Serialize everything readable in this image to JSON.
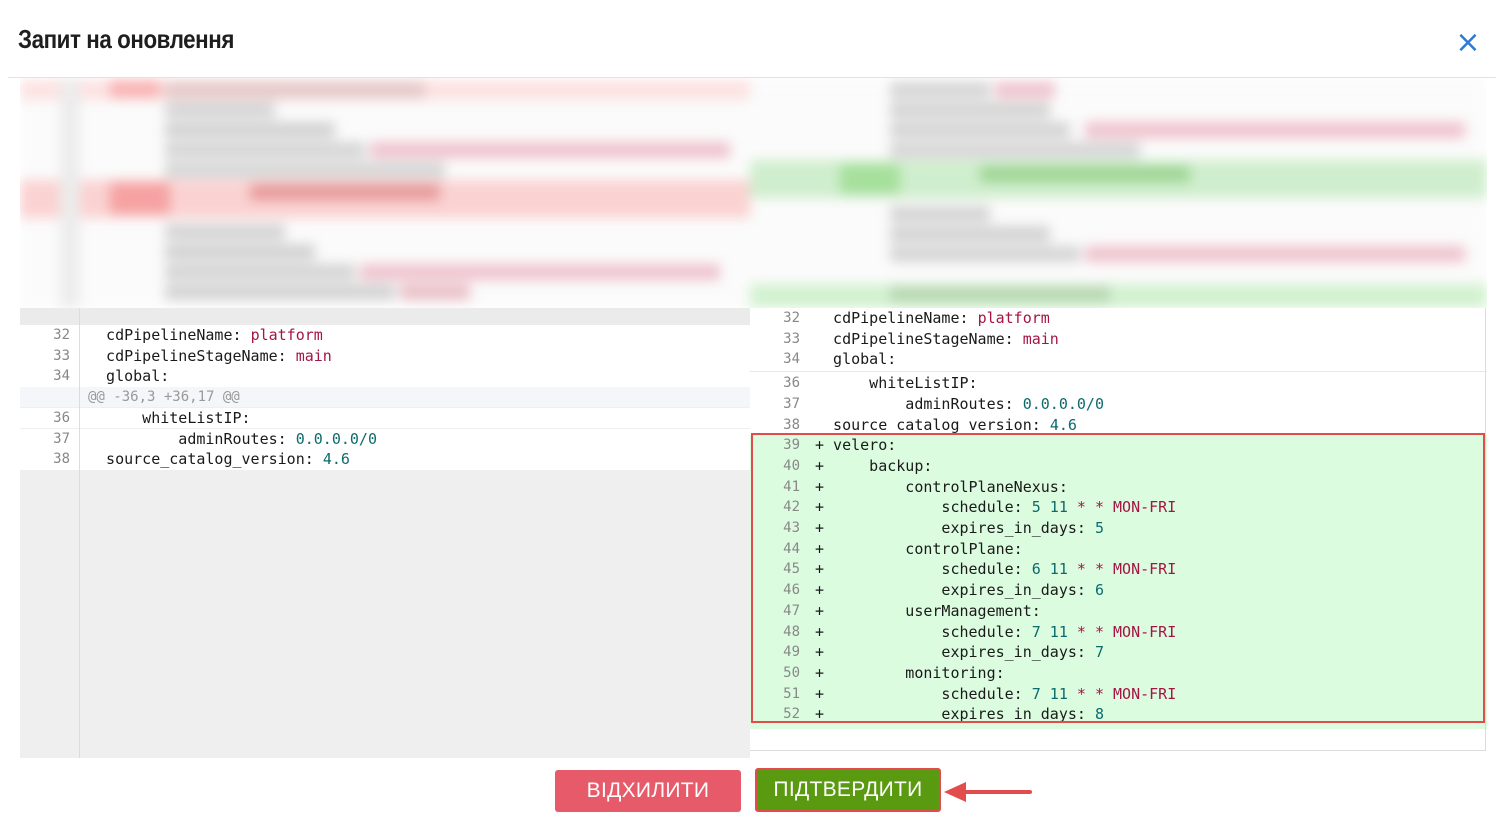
{
  "modal": {
    "title": "Запит на оновлення",
    "close_icon": "×"
  },
  "diff": {
    "hunk_header": "@@ -36,3 +36,17 @@",
    "left_rows": [
      {
        "ln": "32",
        "key": "  cdPipelineName: ",
        "val": "platform",
        "type": "s"
      },
      {
        "ln": "33",
        "key": "  cdPipelineStageName: ",
        "val": "main",
        "type": "s"
      },
      {
        "ln": "34",
        "key": "  global:",
        "val": "",
        "type": ""
      },
      {
        "ln": "36",
        "key": "      whiteListIP:",
        "val": "",
        "type": ""
      },
      {
        "ln": "37",
        "key": "          adminRoutes: ",
        "val": "0.0.0.0/0",
        "type": "n"
      },
      {
        "ln": "38",
        "key": "  source_catalog_version: ",
        "val": "4.6",
        "type": "n"
      }
    ],
    "right_rows": [
      {
        "ln": "32",
        "key": "  cdPipelineName: ",
        "val": "platform",
        "type": "s"
      },
      {
        "ln": "33",
        "key": "  cdPipelineStageName: ",
        "val": "main",
        "type": "s"
      },
      {
        "ln": "34",
        "key": "  global:",
        "val": "",
        "type": ""
      },
      {
        "ln": "36",
        "key": "      whiteListIP:",
        "val": "",
        "type": ""
      },
      {
        "ln": "37",
        "key": "          adminRoutes: ",
        "val": "0.0.0.0/0",
        "type": "n"
      },
      {
        "ln": "38",
        "key": "  source_catalog_version: ",
        "val": "4.6",
        "type": "n"
      }
    ],
    "added_rows": [
      {
        "ln": "39",
        "key": "+ velero:",
        "parts": []
      },
      {
        "ln": "40",
        "key": "+     backup:",
        "parts": []
      },
      {
        "ln": "41",
        "key": "+         controlPlaneNexus:",
        "parts": []
      },
      {
        "ln": "42",
        "key": "+             schedule: ",
        "parts": [
          [
            "5 11",
            "n"
          ],
          [
            " * * ",
            "s"
          ],
          [
            "MON-FRI",
            "s"
          ]
        ]
      },
      {
        "ln": "43",
        "key": "+             expires_in_days: ",
        "parts": [
          [
            "5",
            "n"
          ]
        ]
      },
      {
        "ln": "44",
        "key": "+         controlPlane:",
        "parts": []
      },
      {
        "ln": "45",
        "key": "+             schedule: ",
        "parts": [
          [
            "6 11",
            "n"
          ],
          [
            " * * ",
            "s"
          ],
          [
            "MON-FRI",
            "s"
          ]
        ]
      },
      {
        "ln": "46",
        "key": "+             expires_in_days: ",
        "parts": [
          [
            "6",
            "n"
          ]
        ]
      },
      {
        "ln": "47",
        "key": "+         userManagement:",
        "parts": []
      },
      {
        "ln": "48",
        "key": "+             schedule: ",
        "parts": [
          [
            "7 11",
            "n"
          ],
          [
            " * * ",
            "s"
          ],
          [
            "MON-FRI",
            "s"
          ]
        ]
      },
      {
        "ln": "49",
        "key": "+             expires_in_days: ",
        "parts": [
          [
            "7",
            "n"
          ]
        ]
      },
      {
        "ln": "50",
        "key": "+         monitoring:",
        "parts": []
      },
      {
        "ln": "51",
        "key": "+             schedule: ",
        "parts": [
          [
            "7 11",
            "n"
          ],
          [
            " * * ",
            "s"
          ],
          [
            "MON-FRI",
            "s"
          ]
        ]
      },
      {
        "ln": "52",
        "key": "+             expires_in_days: ",
        "parts": [
          [
            "8",
            "n"
          ]
        ]
      }
    ]
  },
  "buttons": {
    "reject_label": "ВІДХИЛИТИ",
    "confirm_label": "ПІДТВЕРДИТИ"
  },
  "colors": {
    "reject": "#e75a6a",
    "confirm": "#5a9a11",
    "added_bg": "#dcfce0",
    "highlight_border": "#e34c4c"
  },
  "icons": {
    "close": "close-icon",
    "annotation": "arrow-left-icon"
  }
}
